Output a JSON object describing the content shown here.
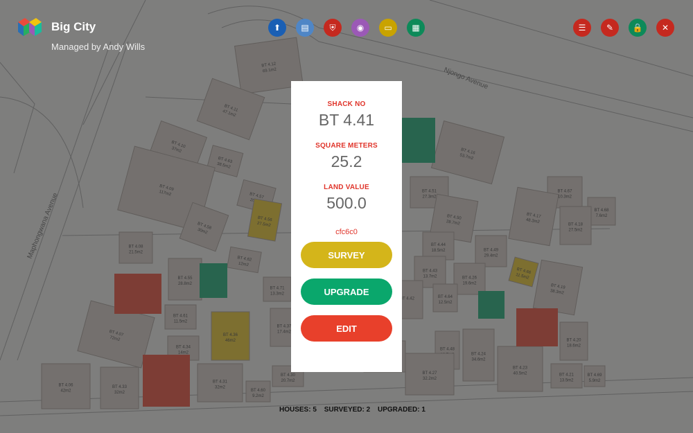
{
  "app": {
    "title": "Big City",
    "subtitle": "Managed by Andy Wills"
  },
  "toolbar": [
    {
      "name": "upload-icon",
      "glyph": "⬆",
      "color": "#1a5fb4"
    },
    {
      "name": "document-icon",
      "glyph": "▤",
      "color": "#4f86c6"
    },
    {
      "name": "shield-icon",
      "glyph": "⛨",
      "color": "#c5291f"
    },
    {
      "name": "record-icon",
      "glyph": "◉",
      "color": "#9b59b6"
    },
    {
      "name": "chat-icon",
      "glyph": "▭",
      "color": "#c9a300"
    },
    {
      "name": "briefcase-icon",
      "glyph": "▦",
      "color": "#0d8a59"
    }
  ],
  "actions": [
    {
      "name": "list-icon",
      "glyph": "☰",
      "color": "#c5291f"
    },
    {
      "name": "pencil-icon",
      "glyph": "✎",
      "color": "#c5291f"
    },
    {
      "name": "lock-icon",
      "glyph": "🔒",
      "color": "#0d8a59"
    },
    {
      "name": "close-icon",
      "glyph": "✕",
      "color": "#c5291f"
    }
  ],
  "panel": {
    "shack_label": "SHACK NO",
    "shack_value": "BT 4.41",
    "sqm_label": "SQUARE METERS",
    "sqm_value": "25.2",
    "land_label": "LAND VALUE",
    "land_value": "500.0",
    "hex": "cfc6c0",
    "buttons": [
      {
        "name": "survey-button",
        "label": "SURVEY",
        "color": "#d4b51a"
      },
      {
        "name": "upgrade-button",
        "label": "UPGRADE",
        "color": "#0aa76c"
      },
      {
        "name": "edit-button",
        "label": "EDIT",
        "color": "#e8402b"
      }
    ]
  },
  "map": {
    "streets": [
      "Njongo Avenue",
      "Maphongwana Avenue"
    ],
    "plots": [
      {
        "id": "BT 4.12",
        "area": "69.1m2",
        "status": "none"
      },
      {
        "id": "BT 4.11",
        "area": "47.1m2",
        "status": "none"
      },
      {
        "id": "BT 4.10",
        "area": "37m2",
        "status": "none"
      },
      {
        "id": "BT 4.63",
        "area": "38.5m2",
        "status": "none"
      },
      {
        "id": "BT 4.09",
        "area": "117m2",
        "status": "none"
      },
      {
        "id": "BT 4.57",
        "area": "20m2",
        "status": "none"
      },
      {
        "id": "BT 4.58",
        "area": "30m2",
        "status": "none"
      },
      {
        "id": "BT 4.56",
        "area": "27.5m2",
        "status": "surveyed"
      },
      {
        "id": "BT 4.08",
        "area": "21.5m2",
        "status": "none"
      },
      {
        "id": "BT 4.62",
        "area": "12m2",
        "status": "none"
      },
      {
        "id": "BT 4.55",
        "area": "28.8m2",
        "status": "none"
      },
      {
        "id": "BT 4.71",
        "area": "13.3m2",
        "status": "none"
      },
      {
        "id": "BT 4.61",
        "area": "11.5m2",
        "status": "none"
      },
      {
        "id": "BT 4.36",
        "area": "46m2",
        "status": "surveyed"
      },
      {
        "id": "BT 4.37",
        "area": "17.4m2",
        "status": "none"
      },
      {
        "id": "BT 4.07",
        "area": "72m2",
        "status": "none"
      },
      {
        "id": "BT 4.34",
        "area": "14m2",
        "status": "none"
      },
      {
        "id": "BT 4.06",
        "area": "42m2",
        "status": "none"
      },
      {
        "id": "BT 4.33",
        "area": "32m2",
        "status": "none"
      },
      {
        "id": "BT 4.31",
        "area": "32m2",
        "status": "none"
      },
      {
        "id": "BT 4.60",
        "area": "9.2m2",
        "status": "none"
      },
      {
        "id": "BT 4.30",
        "area": "20.7m2",
        "status": "none"
      },
      {
        "id": "BT 4.16",
        "area": "53.7m2",
        "status": "none"
      },
      {
        "id": "BT 4.51",
        "area": "27.3m2",
        "status": "none"
      },
      {
        "id": "BT 4.50",
        "area": "28.7m2",
        "status": "none"
      },
      {
        "id": "BT 4.44",
        "area": "18.5m2",
        "status": "none"
      },
      {
        "id": "BT 4.49",
        "area": "29.4m2",
        "status": "none"
      },
      {
        "id": "BT 4.43",
        "area": "13.7m2",
        "status": "none"
      },
      {
        "id": "BT 4.42",
        "area": "",
        "status": "none"
      },
      {
        "id": "BT 4.26",
        "area": "19.6m2",
        "status": "none"
      },
      {
        "id": "BT 4.64",
        "area": "12.5m2",
        "status": "none"
      },
      {
        "id": "BT 4.48",
        "area": "18.7m2",
        "status": "none"
      },
      {
        "id": "BT 4.28",
        "area": "28.8m2",
        "status": "none"
      },
      {
        "id": "BT 4.27",
        "area": "32.2m2",
        "status": "none"
      },
      {
        "id": "BT 4.24",
        "area": "34.6m2",
        "status": "none"
      },
      {
        "id": "BT 4.23",
        "area": "40.5m2",
        "status": "none"
      },
      {
        "id": "BT 4.67",
        "area": "10.3m2",
        "status": "none"
      },
      {
        "id": "BT 4.68",
        "area": "7.6m2",
        "status": "none"
      },
      {
        "id": "BT 4.17",
        "area": "48.3m2",
        "status": "none"
      },
      {
        "id": "BT 4.18",
        "area": "27.5m2",
        "status": "none"
      },
      {
        "id": "BT 4.66",
        "area": "11.5m2",
        "status": "surveyed"
      },
      {
        "id": "BT 4.19",
        "area": "38.3m2",
        "status": "none"
      },
      {
        "id": "BT 4.20",
        "area": "18.6m2",
        "status": "none"
      },
      {
        "id": "BT 4.21",
        "area": "13.5m2",
        "status": "none"
      },
      {
        "id": "BT 4.69",
        "area": "5.9m2",
        "status": "none"
      }
    ]
  },
  "stats": {
    "houses": "HOUSES: 5",
    "surveyed": "SURVEYED: 2",
    "upgraded": "UPGRADED: 1"
  }
}
